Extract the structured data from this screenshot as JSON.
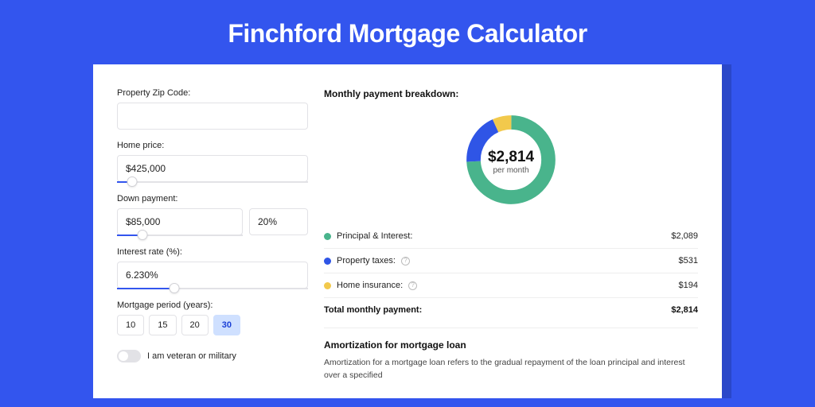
{
  "page_title": "Finchford Mortgage Calculator",
  "form": {
    "zip": {
      "label": "Property Zip Code:",
      "value": ""
    },
    "home_price": {
      "label": "Home price:",
      "value": "$425,000",
      "slider_pct": "8%"
    },
    "down_payment": {
      "label": "Down payment:",
      "amount": "$85,000",
      "percent": "20%",
      "slider_pct": "20%"
    },
    "interest_rate": {
      "label": "Interest rate (%):",
      "value": "6.230%",
      "slider_pct": "30%"
    },
    "period": {
      "label": "Mortgage period (years):",
      "options": [
        "10",
        "15",
        "20",
        "30"
      ],
      "selected": "30"
    },
    "veteran": {
      "label": "I am veteran or military",
      "on": false
    }
  },
  "breakdown": {
    "title": "Monthly payment breakdown:",
    "center_amount": "$2,814",
    "center_sub": "per month",
    "rows": [
      {
        "key": "pi",
        "label": "Principal & Interest:",
        "value": "$2,089",
        "info": false
      },
      {
        "key": "tax",
        "label": "Property taxes:",
        "value": "$531",
        "info": true
      },
      {
        "key": "ins",
        "label": "Home insurance:",
        "value": "$194",
        "info": true
      }
    ],
    "total_label": "Total monthly payment:",
    "total_value": "$2,814"
  },
  "chart_data": {
    "type": "pie",
    "title": "Monthly payment breakdown",
    "series": [
      {
        "name": "Principal & Interest",
        "value": 2089,
        "color": "#49b48c"
      },
      {
        "name": "Property taxes",
        "value": 531,
        "color": "#2f55e6"
      },
      {
        "name": "Home insurance",
        "value": 194,
        "color": "#f2c94c"
      }
    ],
    "total": 2814
  },
  "amortization": {
    "title": "Amortization for mortgage loan",
    "body": "Amortization for a mortgage loan refers to the gradual repayment of the loan principal and interest over a specified"
  }
}
